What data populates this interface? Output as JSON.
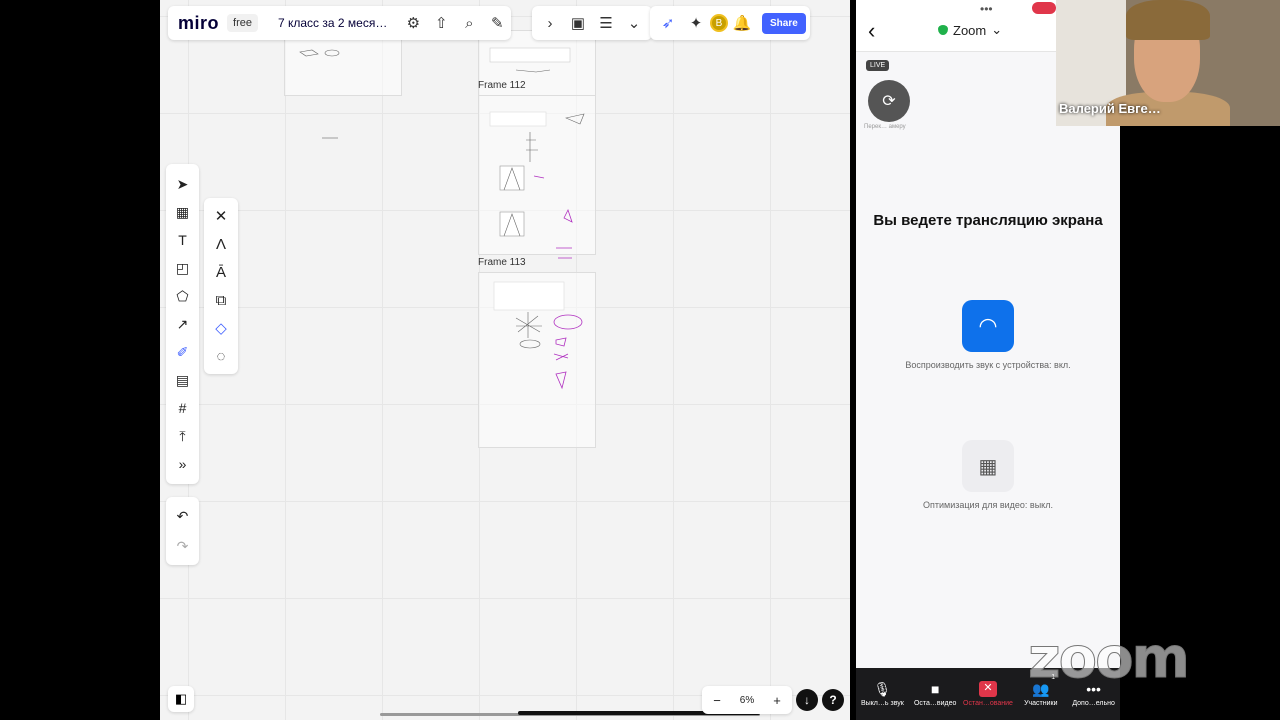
{
  "miro": {
    "logo": "miro",
    "plan": "free",
    "board_title": "7 класс за 2 меся…",
    "share_label": "Share",
    "avatar_letter": "В",
    "frames": [
      {
        "label": "Frame 112"
      },
      {
        "label": "Frame 113"
      }
    ],
    "zoom_level": "6%",
    "minus": "−",
    "plus": "+",
    "help": "?"
  },
  "zoom": {
    "title": "Zoom",
    "live_badge": "LIVE",
    "camera_switch_label": "Перек… амеру",
    "heading": "Вы ведете трансляцию экрана",
    "audio_label": "Воспроизводить звук с устройства: вкл.",
    "video_label": "Оптимизация для видео: выкл.",
    "footer": [
      {
        "label": "Выкл…ь звук"
      },
      {
        "label": "Оста…видео"
      },
      {
        "label": "Остан…ование"
      },
      {
        "label": "Участники"
      },
      {
        "label": "Допо…ельно"
      }
    ],
    "participants_count": "1",
    "speaker_name": "Валерий Евге…",
    "watermark": "zoom"
  },
  "accent_colors": {
    "miro_share": "#4262ff",
    "zoom_blue": "#0e71eb",
    "zoom_red": "#e0364a"
  }
}
